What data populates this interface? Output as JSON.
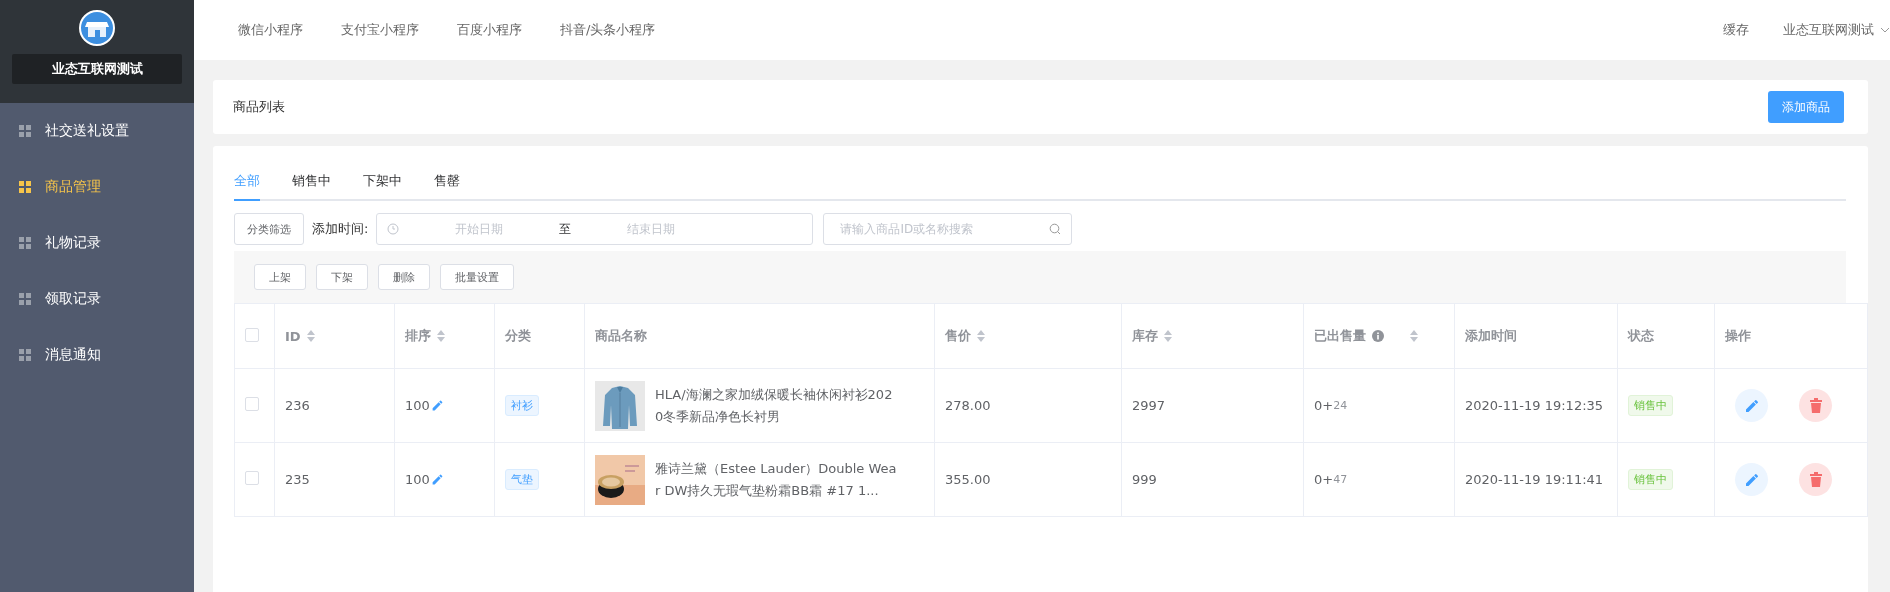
{
  "sidebar": {
    "brand": "业态互联网测试",
    "items": [
      {
        "label": "社交送礼设置",
        "selected": false
      },
      {
        "label": "商品管理",
        "selected": true
      },
      {
        "label": "礼物记录",
        "selected": false
      },
      {
        "label": "领取记录",
        "selected": false
      },
      {
        "label": "消息通知",
        "selected": false
      }
    ]
  },
  "top_nav": {
    "items": [
      "微信小程序",
      "支付宝小程序",
      "百度小程序",
      "抖音/头条小程序"
    ],
    "cache": "缓存",
    "account": "业态互联网测试"
  },
  "header": {
    "title": "商品列表",
    "add_button": "添加商品"
  },
  "tabs": [
    {
      "label": "全部",
      "selected": true
    },
    {
      "label": "销售中",
      "selected": false
    },
    {
      "label": "下架中",
      "selected": false
    },
    {
      "label": "售罄",
      "selected": false
    }
  ],
  "filters": {
    "category_button": "分类筛选",
    "time_label": "添加时间:",
    "start_placeholder": "开始日期",
    "separator": "至",
    "end_placeholder": "结束日期",
    "search_placeholder": "请输入商品ID或名称搜索"
  },
  "actions": [
    "上架",
    "下架",
    "删除",
    "批量设置"
  ],
  "table": {
    "select_all_checked": false,
    "columns": [
      {
        "label": "ID",
        "sortable": true,
        "info": false
      },
      {
        "label": "排序",
        "sortable": true,
        "info": false
      },
      {
        "label": "分类",
        "sortable": false,
        "info": false
      },
      {
        "label": "商品名称",
        "sortable": false,
        "info": false
      },
      {
        "label": "售价",
        "sortable": true,
        "info": false
      },
      {
        "label": "库存",
        "sortable": true,
        "info": false
      },
      {
        "label": "已出售量",
        "sortable": true,
        "info": true
      },
      {
        "label": "添加时间",
        "sortable": false,
        "info": false
      },
      {
        "label": "状态",
        "sortable": false,
        "info": false
      },
      {
        "label": "操作",
        "sortable": false,
        "info": false
      }
    ],
    "rows": [
      {
        "checked": false,
        "id": "236",
        "sort": "100",
        "category": "衬衫",
        "name": "HLA/海澜之家加绒保暖长袖休闲衬衫2020冬季新品净色长衬男",
        "price": "278.00",
        "stock": "2997",
        "sold_base": "0+",
        "sold_extra": "24",
        "added": "2020-11-19 19:12:35",
        "status": "销售中"
      },
      {
        "checked": false,
        "id": "235",
        "sort": "100",
        "category": "气垫",
        "name": "雅诗兰黛（Estee Lauder）Double Wear DW持久无瑕气垫粉霜BB霜 #17 1...",
        "price": "355.00",
        "stock": "999",
        "sold_base": "0+",
        "sold_extra": "47",
        "added": "2020-11-19 19:11:41",
        "status": "销售中"
      }
    ]
  }
}
